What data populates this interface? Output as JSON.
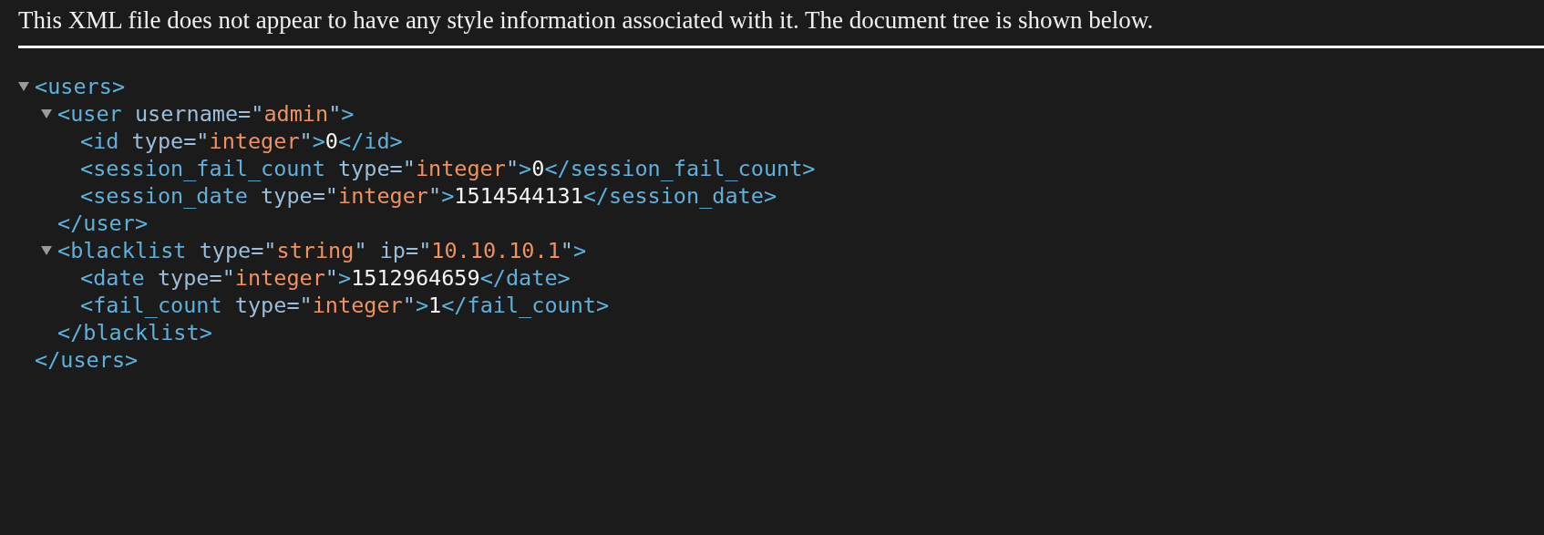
{
  "notice": "This XML file does not appear to have any style information associated with it. The document tree is shown below.",
  "tree": [
    {
      "kind": "element",
      "expanded": true,
      "open": [
        {
          "kind": "tag",
          "text": "<users>"
        }
      ],
      "children": [
        {
          "kind": "element",
          "expanded": true,
          "open": [
            {
              "kind": "tag",
              "text": "<user"
            },
            {
              "kind": "attr",
              "text": " username=\""
            },
            {
              "kind": "value",
              "text": "admin"
            },
            {
              "kind": "attr",
              "text": "\""
            },
            {
              "kind": "tag",
              "text": ">"
            }
          ],
          "children": [
            {
              "kind": "leaf",
              "line": [
                {
                  "kind": "tag",
                  "text": "<id"
                },
                {
                  "kind": "attr",
                  "text": " type=\""
                },
                {
                  "kind": "value",
                  "text": "integer"
                },
                {
                  "kind": "attr",
                  "text": "\""
                },
                {
                  "kind": "tag",
                  "text": ">"
                },
                {
                  "kind": "text",
                  "text": "0"
                },
                {
                  "kind": "tag",
                  "text": "</id>"
                }
              ]
            },
            {
              "kind": "leaf",
              "line": [
                {
                  "kind": "tag",
                  "text": "<session_fail_count"
                },
                {
                  "kind": "attr",
                  "text": " type=\""
                },
                {
                  "kind": "value",
                  "text": "integer"
                },
                {
                  "kind": "attr",
                  "text": "\""
                },
                {
                  "kind": "tag",
                  "text": ">"
                },
                {
                  "kind": "text",
                  "text": "0"
                },
                {
                  "kind": "tag",
                  "text": "</session_fail_count>"
                }
              ]
            },
            {
              "kind": "leaf",
              "line": [
                {
                  "kind": "tag",
                  "text": "<session_date"
                },
                {
                  "kind": "attr",
                  "text": " type=\""
                },
                {
                  "kind": "value",
                  "text": "integer"
                },
                {
                  "kind": "attr",
                  "text": "\""
                },
                {
                  "kind": "tag",
                  "text": ">"
                },
                {
                  "kind": "text",
                  "text": "1514544131"
                },
                {
                  "kind": "tag",
                  "text": "</session_date>"
                }
              ]
            }
          ],
          "close": [
            {
              "kind": "tag",
              "text": "</user>"
            }
          ]
        },
        {
          "kind": "element",
          "expanded": true,
          "open": [
            {
              "kind": "tag",
              "text": "<blacklist"
            },
            {
              "kind": "attr",
              "text": " type=\""
            },
            {
              "kind": "value",
              "text": "string"
            },
            {
              "kind": "attr",
              "text": "\" ip=\""
            },
            {
              "kind": "value",
              "text": "10.10.10.1"
            },
            {
              "kind": "attr",
              "text": "\""
            },
            {
              "kind": "tag",
              "text": ">"
            }
          ],
          "children": [
            {
              "kind": "leaf",
              "line": [
                {
                  "kind": "tag",
                  "text": "<date"
                },
                {
                  "kind": "attr",
                  "text": " type=\""
                },
                {
                  "kind": "value",
                  "text": "integer"
                },
                {
                  "kind": "attr",
                  "text": "\""
                },
                {
                  "kind": "tag",
                  "text": ">"
                },
                {
                  "kind": "text",
                  "text": "1512964659"
                },
                {
                  "kind": "tag",
                  "text": "</date>"
                }
              ]
            },
            {
              "kind": "leaf",
              "line": [
                {
                  "kind": "tag",
                  "text": "<fail_count"
                },
                {
                  "kind": "attr",
                  "text": " type=\""
                },
                {
                  "kind": "value",
                  "text": "integer"
                },
                {
                  "kind": "attr",
                  "text": "\""
                },
                {
                  "kind": "tag",
                  "text": ">"
                },
                {
                  "kind": "text",
                  "text": "1"
                },
                {
                  "kind": "tag",
                  "text": "</fail_count>"
                }
              ]
            }
          ],
          "close": [
            {
              "kind": "tag",
              "text": "</blacklist>"
            }
          ]
        }
      ],
      "close": [
        {
          "kind": "tag",
          "text": "</users>"
        }
      ]
    }
  ]
}
